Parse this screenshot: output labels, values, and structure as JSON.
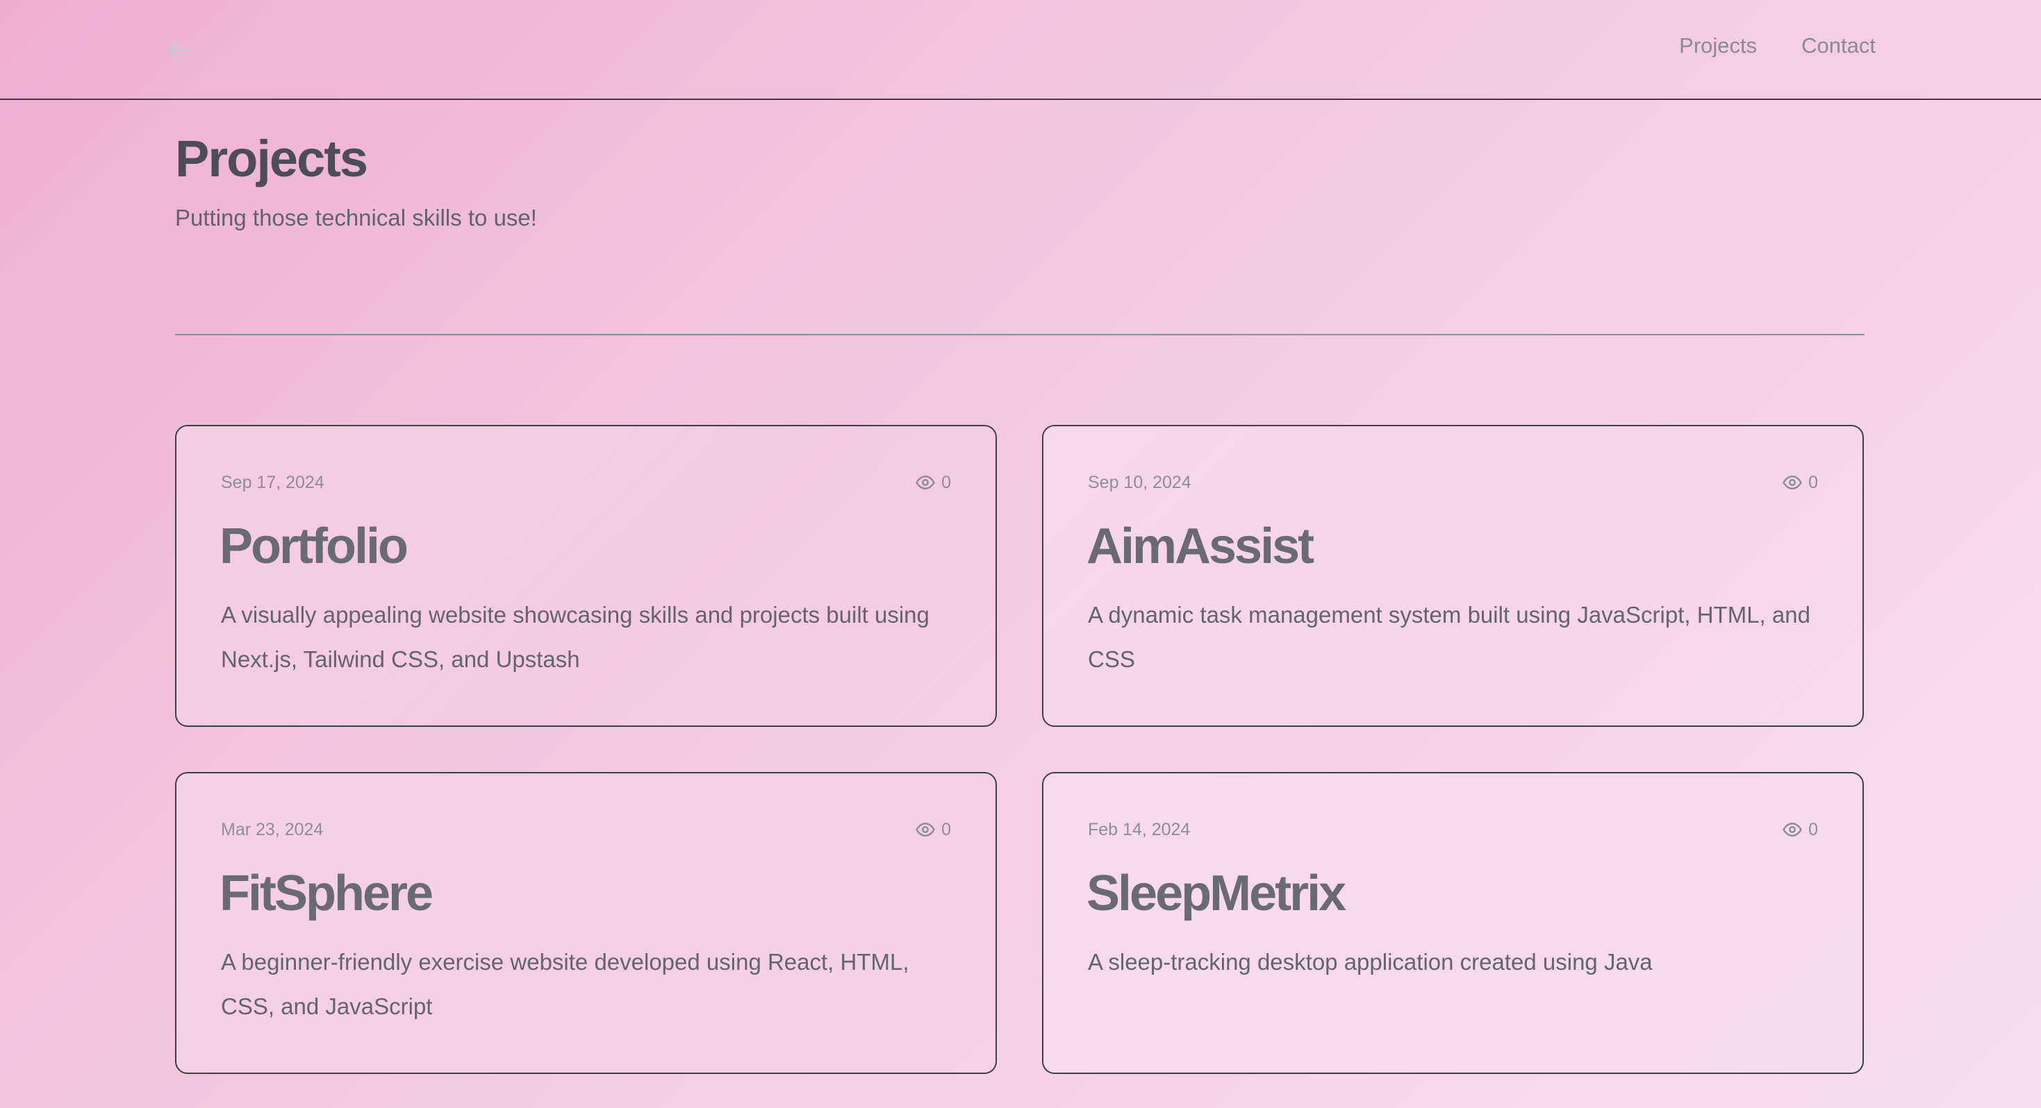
{
  "nav": {
    "back_icon": "arrow-left-icon",
    "links": [
      "Projects",
      "Contact"
    ]
  },
  "header": {
    "title": "Projects",
    "subtitle": "Putting those technical skills to use!"
  },
  "projects": [
    {
      "date": "Sep 17, 2024",
      "views": "0",
      "title": "Portfolio",
      "description": "A visually appealing website showcasing skills and projects built using Next.js, Tailwind CSS, and Upstash"
    },
    {
      "date": "Sep 10, 2024",
      "views": "0",
      "title": "AimAssist",
      "description": "A dynamic task management system built using JavaScript, HTML, and CSS"
    },
    {
      "date": "Mar 23, 2024",
      "views": "0",
      "title": "FitSphere",
      "description": "A beginner-friendly exercise website developed using React, HTML, CSS, and JavaScript"
    },
    {
      "date": "Feb 14, 2024",
      "views": "0",
      "title": "SleepMetrix",
      "description": "A sleep-tracking desktop application created using Java"
    }
  ],
  "icons": {
    "views": "eye-icon"
  },
  "colors": {
    "border": "#3f3f4a",
    "title_text": "#4c4c5c",
    "muted_text": "#8e8e98"
  }
}
